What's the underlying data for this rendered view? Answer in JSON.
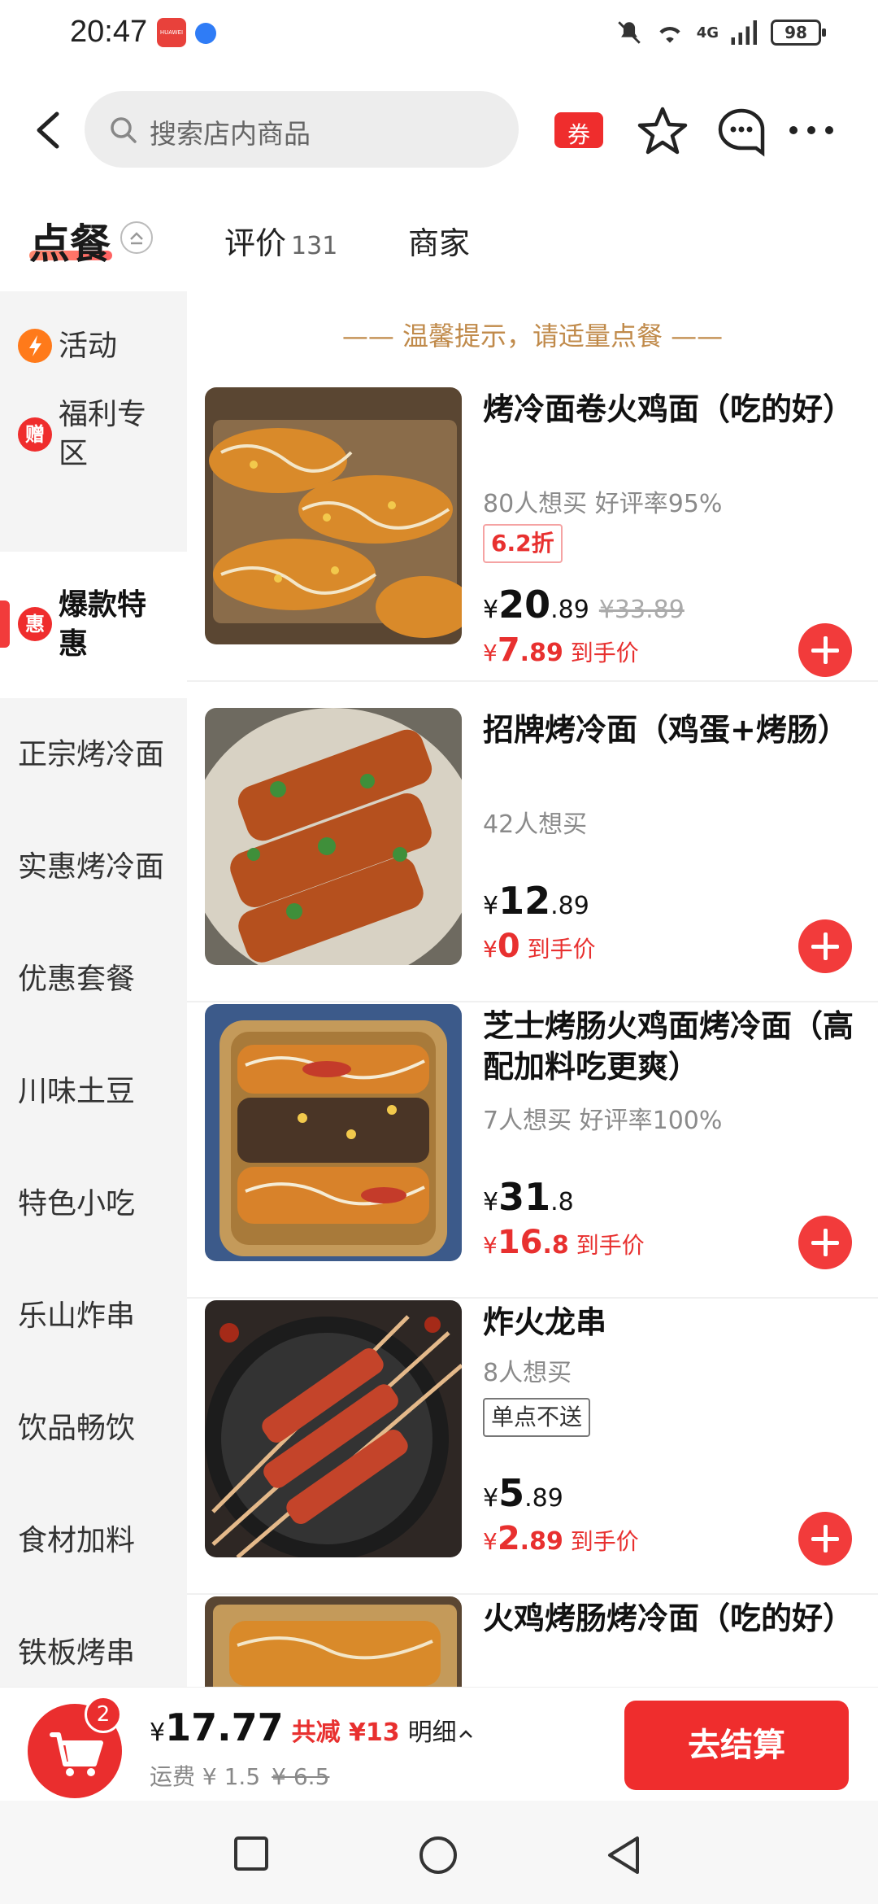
{
  "status": {
    "time": "20:47",
    "app_badge": "HUAWEI",
    "network": "4G",
    "battery": "98"
  },
  "nav": {
    "search_placeholder": "搜索店内商品",
    "coupon_label": "券"
  },
  "tabs": {
    "order": "点餐",
    "review": "评价",
    "review_count": "131",
    "merchant": "商家"
  },
  "sidebar": {
    "items": [
      {
        "label": "活动",
        "badge": ""
      },
      {
        "label": "福利专区",
        "badge": "赠"
      },
      {
        "label": "爆款特惠",
        "badge": "惠"
      },
      {
        "label": "正宗烤冷面"
      },
      {
        "label": "实惠烤冷面"
      },
      {
        "label": "优惠套餐"
      },
      {
        "label": "川味土豆"
      },
      {
        "label": "特色小吃"
      },
      {
        "label": "乐山炸串"
      },
      {
        "label": "饮品畅饮"
      },
      {
        "label": "食材加料"
      },
      {
        "label": "铁板烤串"
      }
    ]
  },
  "content": {
    "tip": "—— 温馨提示，请适量点餐 ——",
    "products": [
      {
        "name": "烤冷面卷火鸡面（吃的好）",
        "meta": "80人想买  好评率95%",
        "tag": "6.2折",
        "price_int": "20",
        "price_dec": ".89",
        "orig": "¥33.89",
        "final_int": "7",
        "final_dec": ".89",
        "final_label": "到手价"
      },
      {
        "name": "招牌烤冷面（鸡蛋+烤肠）",
        "meta": "42人想买",
        "tag": "",
        "price_int": "12",
        "price_dec": ".89",
        "orig": "",
        "final_int": "0",
        "final_dec": "",
        "final_label": "到手价"
      },
      {
        "name": "芝士烤肠火鸡面烤冷面（高配加料吃更爽）",
        "meta": "7人想买  好评率100%",
        "tag": "",
        "price_int": "31",
        "price_dec": ".8",
        "orig": "",
        "final_int": "16",
        "final_dec": ".8",
        "final_label": "到手价"
      },
      {
        "name": "炸火龙串",
        "meta": "8人想买",
        "tag": "单点不送",
        "price_int": "5",
        "price_dec": ".89",
        "orig": "",
        "final_int": "2",
        "final_dec": ".89",
        "final_label": "到手价"
      },
      {
        "name": "火鸡烤肠烤冷面（吃的好）",
        "meta": "",
        "tag": ""
      }
    ],
    "currency": "¥"
  },
  "cart": {
    "count": "2",
    "total": "17.77",
    "discount": "共减 ¥13",
    "detail": "明细",
    "shipping": "运费 ¥ 1.5",
    "shipping_orig": "¥ 6.5",
    "checkout": "去结算"
  },
  "colors": {
    "accent": "#f23b3b",
    "tip": "#c08a4a"
  }
}
